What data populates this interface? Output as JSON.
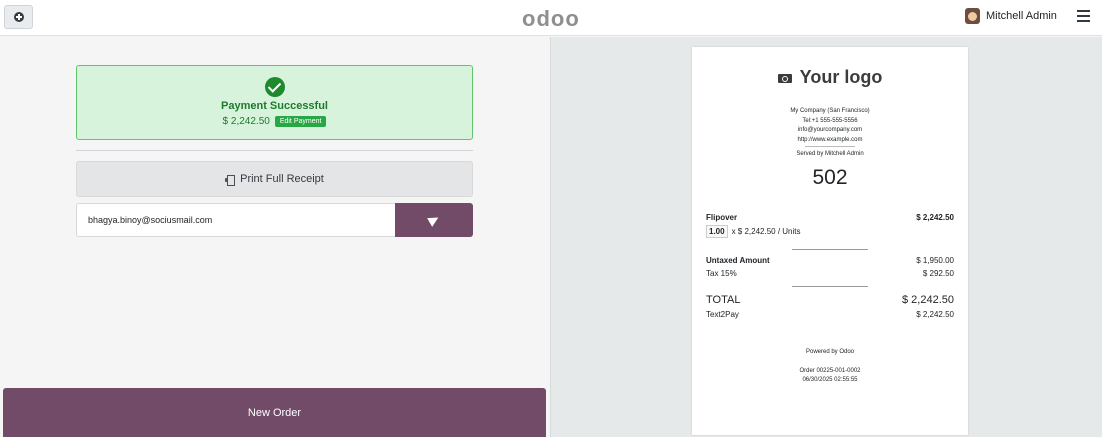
{
  "topbar": {
    "brand": "odoo",
    "user_name": "Mitchell Admin"
  },
  "payment": {
    "title": "Payment Successful",
    "amount": "$ 2,242.50",
    "edit_label": "Edit Payment"
  },
  "actions": {
    "print_label": "Print Full Receipt",
    "email_value": "bhagya.binoy@sociusmail.com",
    "new_order_label": "New Order"
  },
  "receipt": {
    "logo_text": "Your logo",
    "company_name": "My Company (San Francisco)",
    "tel": "Tel:+1 555-555-5556",
    "email": "info@yourcompany.com",
    "website": "http://www.example.com",
    "served_by": "Served by Mitchell Admin",
    "order_number": "502",
    "line": {
      "product": "Flipover",
      "price": "$ 2,242.50",
      "qty": "1.00",
      "unit_desc": "x $ 2,242.50 / Units"
    },
    "untaxed_label": "Untaxed Amount",
    "untaxed_value": "$ 1,950.00",
    "tax_label": "Tax 15%",
    "tax_value": "$ 292.50",
    "total_label": "TOTAL",
    "total_value": "$ 2,242.50",
    "payment_method": "Text2Pay",
    "payment_value": "$ 2,242.50",
    "powered_by": "Powered by Odoo",
    "order_ref": "Order 00225-001-0002",
    "order_datetime": "06/30/2025 02:55:55"
  },
  "colors": {
    "primary": "#714b67",
    "success_bg": "#d7f3dc",
    "success_text": "#1f7a2b"
  },
  "icons": [
    "plus-circle-icon",
    "user-avatar-icon",
    "hamburger-menu-icon",
    "check-circle-icon",
    "print-icon",
    "send-icon",
    "camera-icon"
  ]
}
